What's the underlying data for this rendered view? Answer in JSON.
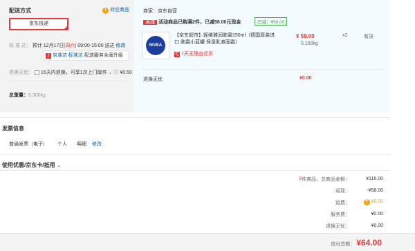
{
  "shipping": {
    "title": "配送方式",
    "matching_icon": "info-icon",
    "matching_link": "对应商品",
    "method": "京东快递",
    "eta_label": "标 准 达：",
    "eta_text": "预计 12月17日",
    "eta_day": "[周六]",
    "eta_time": "09:00-15:00 送达",
    "edit": "修改",
    "upgrade_badge_icon": "J",
    "upgrade_brand1": "京准达",
    "upgrade_brand2": "标准达",
    "upgrade_text": "配送服务全面升级",
    "return_label": "退换无忧：",
    "return_text": "15天内退换，可享1次上门取件",
    "return_price": "¥0.50",
    "weight_label": "总重量：",
    "weight_value": "0.300kg"
  },
  "store": {
    "seller": "商家：京东自营",
    "promo_tag": "满减",
    "promo_text": "活动商品已购满2件，已减58.00元现金",
    "saved_tag": "已减：¥58.00",
    "product_title": "【京东超市】妮维雅润肤霜150ml（德国原装进口 肤霜小蓝罐 保湿乳液面霜）",
    "product_image_text": "NIVEA",
    "return7_icon": "七",
    "return7_text": "7天无理由退货",
    "price": "¥ 58.00",
    "weight": "0.150kg",
    "qty": "x2",
    "stock": "有货",
    "noworry_label": "退换无忧",
    "noworry_price": "¥0.00"
  },
  "invoice": {
    "title": "发票信息",
    "type": "普通发票（电子）",
    "holder": "个人",
    "detail": "明细",
    "edit": "修改"
  },
  "coupon": {
    "title": "使用优惠/京东卡/抵用",
    "chevron_icon": "chevron-down-icon"
  },
  "summary": {
    "items_count": "2",
    "items_label": "件商品，总商品金额：",
    "items_value": "¥116.00",
    "discount_label": "返现：",
    "discount_value": "-¥58.00",
    "freight_label": "运费：",
    "freight_value": "¥6.00",
    "service_label": "服务费：",
    "service_value": "¥0.00",
    "noworry_label": "退换无忧：",
    "noworry_value": "¥0.00"
  },
  "total": {
    "label": "应付总额：",
    "value": "¥64.00"
  }
}
